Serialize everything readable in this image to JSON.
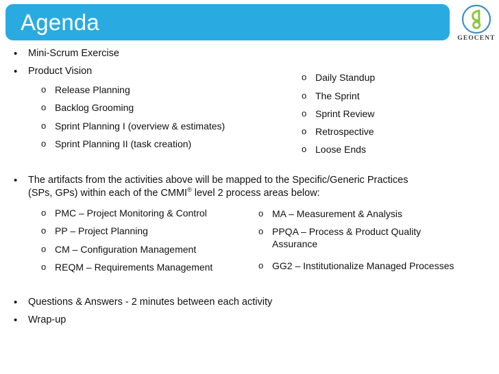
{
  "slide": {
    "title": "Agenda",
    "accent_color": "#29abe2",
    "text_color": "#111111",
    "background_color": "#ffffff"
  },
  "logo": {
    "wordmark": "GEOCENT",
    "mark_letters": "go",
    "ring_color": "#3a8fbf",
    "letter_color": "#8cc63f",
    "icon_name": "geocent-logo-icon"
  },
  "bullets": {
    "mini_scrum": "Mini-Scrum Exercise",
    "product_vision": "Product Vision",
    "artifacts": "The artifacts from the activities above will be mapped to the Specific/Generic Practices (SPs, GPs) within each of the CMMI",
    "artifacts_sup": "®",
    "artifacts_tail": " level 2 process areas below:",
    "questions": "Questions & Answers  - 2 minutes between each activity",
    "wrap_up": "Wrap-up"
  },
  "activities_left": [
    "Release Planning",
    "Backlog Grooming",
    "Sprint Planning I (overview & estimates)",
    "Sprint Planning II (task creation)"
  ],
  "activities_right": [
    "Daily Standup",
    "The Sprint",
    "Sprint Review",
    "Retrospective",
    "Loose Ends"
  ],
  "process_areas_left": [
    "PMC – Project Monitoring & Control",
    "PP – Project Planning",
    "CM – Configuration Management",
    "REQM – Requirements Management"
  ],
  "process_areas_right": [
    "MA – Measurement & Analysis",
    "PPQA – Process & Product Quality Assurance",
    "GG2 – Institutionalize Managed Processes"
  ],
  "markers": {
    "level1": "•",
    "level2": "o"
  }
}
